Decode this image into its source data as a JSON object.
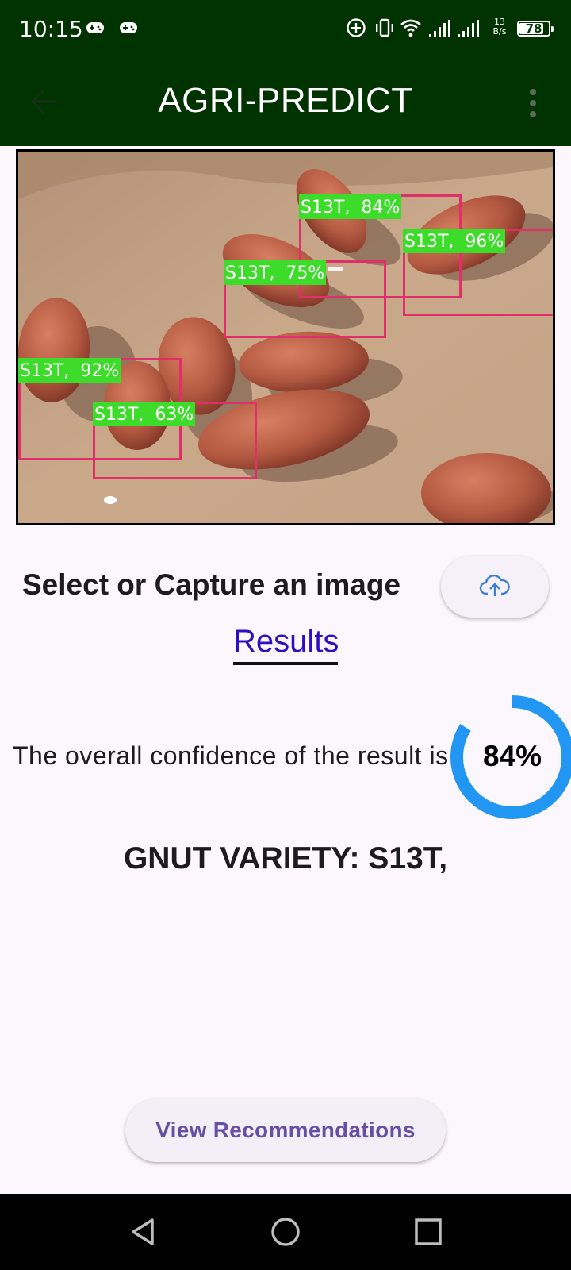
{
  "status_bar": {
    "time": "10:15",
    "net_speed_value": "13",
    "net_speed_unit": "B/s",
    "battery": "78",
    "icons": [
      "gamepad-icon",
      "gamepad-icon",
      "add-circle-icon",
      "vibrate-icon",
      "wifi-icon",
      "signal-icon",
      "signal-icon",
      "battery-icon"
    ]
  },
  "app_bar": {
    "title": "AGRI-PREDICT",
    "back_icon": "arrow-back-icon",
    "menu_icon": "more-vert-icon",
    "background": "#003300"
  },
  "detections": [
    {
      "label": "S13T,  84%"
    },
    {
      "label": "S13T,  96%"
    },
    {
      "label": "S13T,  75%"
    },
    {
      "label": "S13T,  92%"
    },
    {
      "label": "S13T,  63%"
    }
  ],
  "colors": {
    "box": "#e0306a",
    "label_bg": "#3ddc2a",
    "accent_blue": "#2196f3",
    "results_link": "#2d0fc2",
    "button_text": "#6750a4"
  },
  "select": {
    "label": "Select or Capture an image",
    "upload_icon": "cloud-upload-icon"
  },
  "results_tab": "Results",
  "confidence": {
    "text": "The overall confidence of the result is",
    "value_label": "84%",
    "fraction": 0.84
  },
  "variety": "GNUT VARIETY: S13T,",
  "recommend_button": "View Recommendations",
  "nav_bar": {
    "icons": [
      "back-triangle-icon",
      "home-circle-icon",
      "recents-square-icon"
    ]
  }
}
